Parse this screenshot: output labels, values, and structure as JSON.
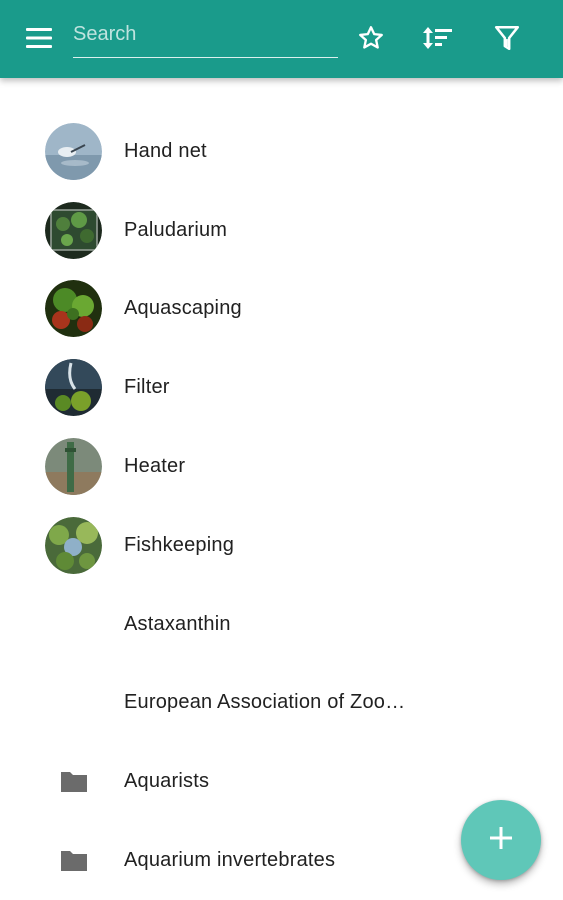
{
  "toolbar": {
    "color": "#1a9b8b",
    "menu_icon": "hamburger-menu-icon",
    "search": {
      "placeholder": "Search",
      "value": ""
    },
    "actions": [
      "star-icon",
      "sort-icon",
      "filter-icon"
    ]
  },
  "items": [
    {
      "label": "Hand net",
      "leading": "thumbnail"
    },
    {
      "label": "Paludarium",
      "leading": "thumbnail"
    },
    {
      "label": "Aquascaping",
      "leading": "thumbnail"
    },
    {
      "label": "Filter",
      "leading": "thumbnail"
    },
    {
      "label": "Heater",
      "leading": "thumbnail"
    },
    {
      "label": "Fishkeeping",
      "leading": "thumbnail"
    },
    {
      "label": "Astaxanthin",
      "leading": "none"
    },
    {
      "label": "European Association of Zoo…",
      "leading": "none"
    },
    {
      "label": "Aquarists",
      "leading": "folder-icon"
    },
    {
      "label": "Aquarium invertebrates",
      "leading": "folder-icon"
    }
  ],
  "fab": {
    "icon": "plus-icon",
    "color": "#5fc7b8"
  }
}
